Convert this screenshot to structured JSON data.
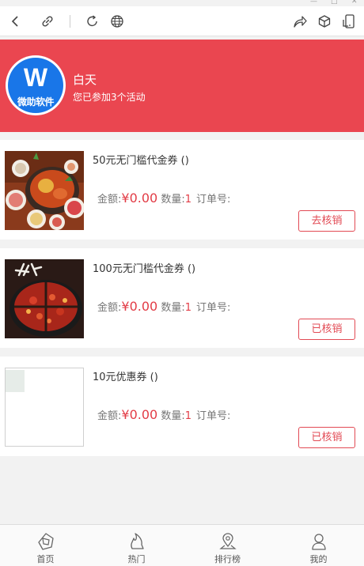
{
  "window": {
    "minimize": "—",
    "maximize": "□",
    "close": "✕"
  },
  "toolbar": {
    "icons": [
      "back-icon",
      "link-icon",
      "refresh-icon",
      "globe-icon",
      "share-icon",
      "cube-icon",
      "phone-icon"
    ]
  },
  "header": {
    "avatar_letter": "W",
    "avatar_text": "微助软件",
    "user_name": "白天",
    "subtitle": "您已参加3个活动",
    "bg_color": "#ea4650"
  },
  "coupons": [
    {
      "title": "50元无门槛代金券 ()",
      "amount_label": "金额:",
      "amount": "¥0.00",
      "qty_label": "数量:",
      "qty": "1",
      "order_label": "订单号:",
      "button": "去核销"
    },
    {
      "title": "100元无门槛代金券 ()",
      "amount_label": "金额:",
      "amount": "¥0.00",
      "qty_label": "数量:",
      "qty": "1",
      "order_label": "订单号:",
      "button": "已核销"
    },
    {
      "title": "10元优惠券 ()",
      "amount_label": "金额:",
      "amount": "¥0.00",
      "qty_label": "数量:",
      "qty": "1",
      "order_label": "订单号:",
      "button": "已核销"
    }
  ],
  "bottom_nav": [
    {
      "label": "首页",
      "icon": "home-icon"
    },
    {
      "label": "热门",
      "icon": "hot-icon"
    },
    {
      "label": "排行榜",
      "icon": "location-icon"
    },
    {
      "label": "我的",
      "icon": "user-icon"
    }
  ]
}
